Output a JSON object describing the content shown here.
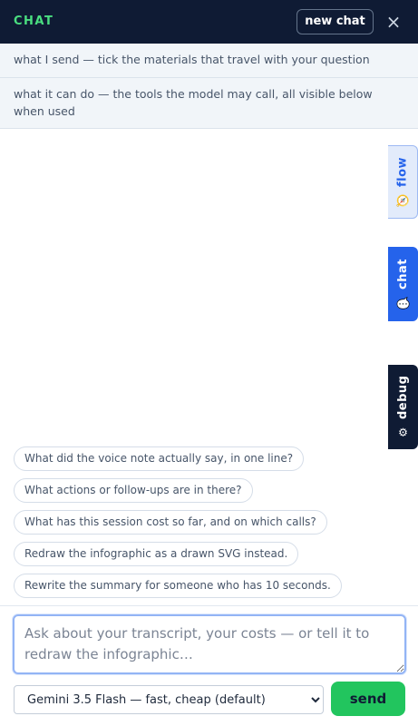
{
  "header": {
    "title": "CHAT",
    "new_chat_label": "new chat",
    "close_glyph": "×"
  },
  "sections": {
    "send": "what I send — tick the materials that travel with your question",
    "tools": "what it can do — the tools the model may call, all visible below when used"
  },
  "side_tabs": [
    {
      "label": "flow",
      "icon": "compass-icon",
      "glyph": "🧭"
    },
    {
      "label": "chat",
      "icon": "chat-bubble-icon",
      "glyph": "💬"
    },
    {
      "label": "debug",
      "icon": "gear-icon",
      "glyph": "⚙"
    }
  ],
  "suggestions": [
    "What did the voice note actually say, in one line?",
    "What actions or follow-ups are in there?",
    "What has this session cost so far, and on which calls?",
    "Redraw the infographic as a drawn SVG instead.",
    "Rewrite the summary for someone who has 10 seconds."
  ],
  "composer": {
    "placeholder": "Ask about your transcript, your costs — or tell it to redraw the infographic…",
    "model_selected": "Gemini 3.5 Flash — fast, cheap (default)",
    "send_label": "send"
  },
  "colors": {
    "header_bg": "#0f1b34",
    "accent_green": "#22c55e",
    "accent_blue": "#2563eb"
  }
}
